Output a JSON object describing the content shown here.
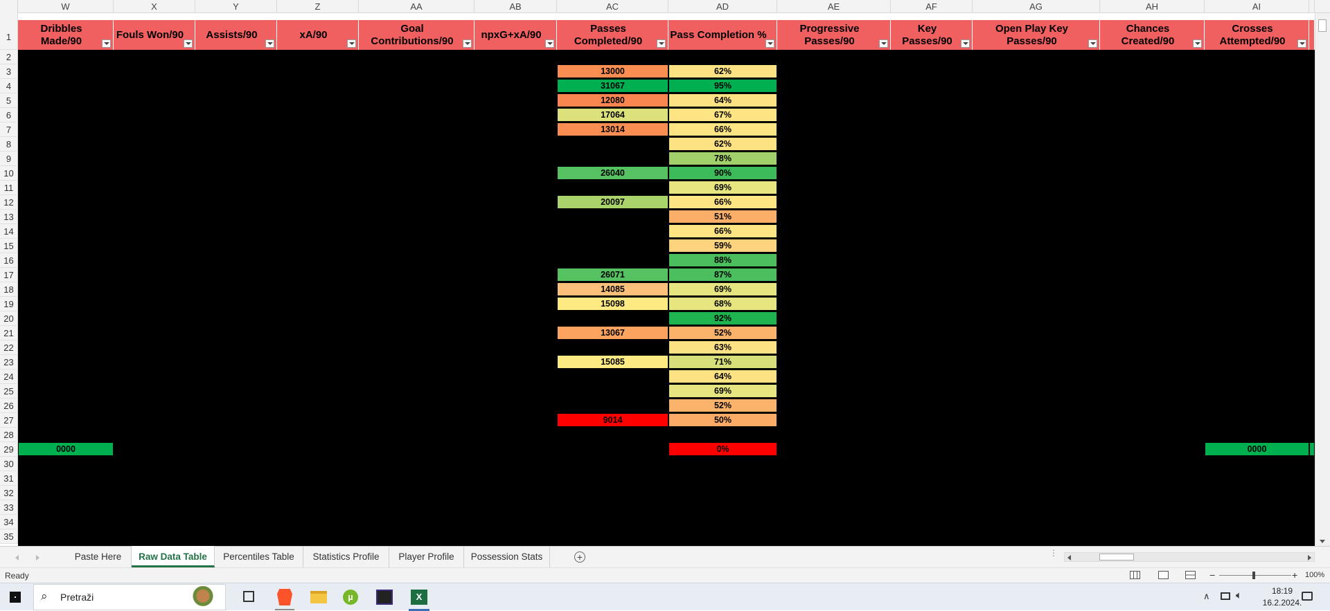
{
  "colors": {
    "header_red": "#f16060",
    "excel_green": "#217346",
    "grid_background": "#000000"
  },
  "columns": [
    {
      "letter": "W",
      "header": "Dribbles Made/90"
    },
    {
      "letter": "X",
      "header": "Fouls Won/90"
    },
    {
      "letter": "Y",
      "header": "Assists/90"
    },
    {
      "letter": "Z",
      "header": "xA/90"
    },
    {
      "letter": "AA",
      "header": "Goal Contributions/90"
    },
    {
      "letter": "AB",
      "header": "npxG+xA/90"
    },
    {
      "letter": "AC",
      "header": "Passes Completed/90"
    },
    {
      "letter": "AD",
      "header": "Pass Completion %"
    },
    {
      "letter": "AE",
      "header": "Progressive Passes/90"
    },
    {
      "letter": "AF",
      "header": "Key Passes/90"
    },
    {
      "letter": "AG",
      "header": "Open Play Key Passes/90"
    },
    {
      "letter": "AH",
      "header": "Chances Created/90"
    },
    {
      "letter": "AI",
      "header": "Crosses\nAttempted/90"
    }
  ],
  "row_numbers": [
    "1",
    "2",
    "3",
    "4",
    "5",
    "6",
    "7",
    "8",
    "9",
    "10",
    "11",
    "12",
    "13",
    "14",
    "15",
    "16",
    "17",
    "18",
    "19",
    "20",
    "21",
    "22",
    "23",
    "24",
    "25",
    "26",
    "27",
    "28",
    "29",
    "30",
    "31",
    "32",
    "33",
    "34",
    "35"
  ],
  "passes_completed": [
    {
      "row": 3,
      "value": "13000",
      "color": "#fa8e52"
    },
    {
      "row": 4,
      "value": "31067",
      "color": "#00b050"
    },
    {
      "row": 5,
      "value": "12080",
      "color": "#f98651"
    },
    {
      "row": 6,
      "value": "17064",
      "color": "#dde17b"
    },
    {
      "row": 7,
      "value": "13014",
      "color": "#fa8e52"
    },
    {
      "row": 10,
      "value": "26040",
      "color": "#56c160"
    },
    {
      "row": 12,
      "value": "20097",
      "color": "#aad36b"
    },
    {
      "row": 17,
      "value": "26071",
      "color": "#56c160"
    },
    {
      "row": 18,
      "value": "14085",
      "color": "#fdc07b"
    },
    {
      "row": 19,
      "value": "15098",
      "color": "#feea83"
    },
    {
      "row": 21,
      "value": "13067",
      "color": "#fba35f"
    },
    {
      "row": 23,
      "value": "15085",
      "color": "#feea83"
    },
    {
      "row": 27,
      "value": "9014",
      "color": "#ff0000"
    }
  ],
  "pass_completion": [
    {
      "row": 3,
      "value": "62%",
      "color": "#fde283"
    },
    {
      "row": 4,
      "value": "95%",
      "color": "#00b050"
    },
    {
      "row": 5,
      "value": "64%",
      "color": "#fde283"
    },
    {
      "row": 6,
      "value": "67%",
      "color": "#fde583"
    },
    {
      "row": 7,
      "value": "66%",
      "color": "#fde583"
    },
    {
      "row": 8,
      "value": "62%",
      "color": "#fde283"
    },
    {
      "row": 9,
      "value": "78%",
      "color": "#a2d06a"
    },
    {
      "row": 10,
      "value": "90%",
      "color": "#3dba59"
    },
    {
      "row": 11,
      "value": "69%",
      "color": "#e7e57f"
    },
    {
      "row": 12,
      "value": "66%",
      "color": "#fde583"
    },
    {
      "row": 13,
      "value": "51%",
      "color": "#fbae68"
    },
    {
      "row": 14,
      "value": "66%",
      "color": "#fde583"
    },
    {
      "row": 15,
      "value": "59%",
      "color": "#fdd37e"
    },
    {
      "row": 16,
      "value": "88%",
      "color": "#4bbe5d"
    },
    {
      "row": 17,
      "value": "87%",
      "color": "#4bbe5d"
    },
    {
      "row": 18,
      "value": "69%",
      "color": "#e7e57f"
    },
    {
      "row": 19,
      "value": "68%",
      "color": "#e7e57f"
    },
    {
      "row": 20,
      "value": "92%",
      "color": "#1fb350"
    },
    {
      "row": 21,
      "value": "52%",
      "color": "#fbb26a"
    },
    {
      "row": 22,
      "value": "63%",
      "color": "#fde283"
    },
    {
      "row": 23,
      "value": "71%",
      "color": "#d6df79"
    },
    {
      "row": 24,
      "value": "64%",
      "color": "#fde283"
    },
    {
      "row": 25,
      "value": "69%",
      "color": "#e7e57f"
    },
    {
      "row": 26,
      "value": "52%",
      "color": "#fbb26a"
    },
    {
      "row": 27,
      "value": "50%",
      "color": "#fbab66"
    },
    {
      "row": 29,
      "value": "0%",
      "color": "#ff0000"
    }
  ],
  "row29": {
    "dribbles": "0000",
    "crosses": "0000",
    "color": "#00b050"
  },
  "tabs": [
    "Paste Here",
    "Raw Data Table",
    "Percentiles Table",
    "Statistics Profile",
    "Player Profile",
    "Possession Stats"
  ],
  "active_tab": "Raw Data Table",
  "status": {
    "ready": "Ready",
    "zoom": "100%"
  },
  "taskbar": {
    "search_placeholder": "Pretraži",
    "time": "18:19",
    "date": "16.2.2024."
  }
}
